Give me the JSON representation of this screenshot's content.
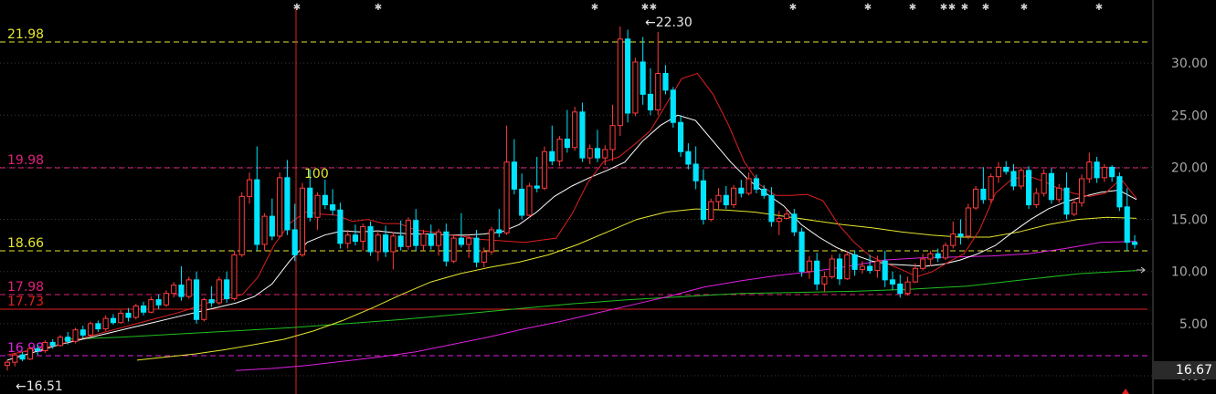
{
  "levels": [
    {
      "label": "21.98",
      "color": "#e6e62e"
    },
    {
      "label": "19.98",
      "color": "#e0207a"
    },
    {
      "label": "18.66",
      "color": "#e6e62e"
    },
    {
      "label": "17.98",
      "color": "#e0207a"
    },
    {
      "label": "17.73",
      "color": "#e02020"
    },
    {
      "label": "16.98",
      "color": "#e020e0"
    }
  ],
  "annotations": {
    "high": "22.30",
    "low": "16.51",
    "marker": "100"
  },
  "current_price": "16.67",
  "chart_data": {
    "type": "candlestick",
    "y_ticks": [
      "30.00",
      "25.00",
      "20.00",
      "15.00",
      "10.00",
      "5.00",
      "0.00"
    ],
    "ylim": [
      0,
      32
    ],
    "ma_colors": {
      "ma_fast": "#e02020",
      "ma_mid": "#ffffff",
      "ma_slow": "#e6e62e",
      "ma_long1": "#e020e0",
      "ma_long2": "#20c020"
    },
    "colors": {
      "up": "#ff3c3c",
      "down": "#00e5ff"
    },
    "candles": [
      [
        1.0,
        1.5,
        0.5,
        1.3
      ],
      [
        1.3,
        2.2,
        0.9,
        2.0
      ],
      [
        2.0,
        2.3,
        1.4,
        1.6
      ],
      [
        1.6,
        2.8,
        1.5,
        2.6
      ],
      [
        2.6,
        3.0,
        2.0,
        2.4
      ],
      [
        2.4,
        3.4,
        2.2,
        3.2
      ],
      [
        3.2,
        3.5,
        2.6,
        2.9
      ],
      [
        2.9,
        3.9,
        2.8,
        3.7
      ],
      [
        3.7,
        4.2,
        3.0,
        3.3
      ],
      [
        3.3,
        4.6,
        3.1,
        4.4
      ],
      [
        4.4,
        4.8,
        3.6,
        3.9
      ],
      [
        3.9,
        5.2,
        3.7,
        5.0
      ],
      [
        5.0,
        5.3,
        4.2,
        4.5
      ],
      [
        4.5,
        5.8,
        4.3,
        5.5
      ],
      [
        5.5,
        5.9,
        4.9,
        5.1
      ],
      [
        5.1,
        6.3,
        5.0,
        6.0
      ],
      [
        6.0,
        6.5,
        5.2,
        5.6
      ],
      [
        5.6,
        6.9,
        5.4,
        6.7
      ],
      [
        6.7,
        7.1,
        5.8,
        6.1
      ],
      [
        6.1,
        7.6,
        6.0,
        7.3
      ],
      [
        7.3,
        7.8,
        6.4,
        6.8
      ],
      [
        6.8,
        8.2,
        6.6,
        7.9
      ],
      [
        7.9,
        9.0,
        7.5,
        8.7
      ],
      [
        8.7,
        10.5,
        7.2,
        7.6
      ],
      [
        7.6,
        9.5,
        7.4,
        9.2
      ],
      [
        9.2,
        10.0,
        5.0,
        5.4
      ],
      [
        5.4,
        7.5,
        5.2,
        7.3
      ],
      [
        7.3,
        8.6,
        6.6,
        7.0
      ],
      [
        7.0,
        9.5,
        6.8,
        9.2
      ],
      [
        9.2,
        10.0,
        7.0,
        7.4
      ],
      [
        7.4,
        12.0,
        7.2,
        11.6
      ],
      [
        11.6,
        17.6,
        11.4,
        17.2
      ],
      [
        17.2,
        19.5,
        16.5,
        18.8
      ],
      [
        18.8,
        22.0,
        12.0,
        12.6
      ],
      [
        12.6,
        15.6,
        12.0,
        15.3
      ],
      [
        15.3,
        17.0,
        13.0,
        13.4
      ],
      [
        13.4,
        19.5,
        13.2,
        19.0
      ],
      [
        19.0,
        20.7,
        13.5,
        14.0
      ],
      [
        14.0,
        16.5,
        11.0,
        11.6
      ],
      [
        11.6,
        18.5,
        11.4,
        18.0
      ],
      [
        18.0,
        19.8,
        14.8,
        15.2
      ],
      [
        15.2,
        17.6,
        14.0,
        17.3
      ],
      [
        17.3,
        18.8,
        16.0,
        16.4
      ],
      [
        16.4,
        17.9,
        15.4,
        15.9
      ],
      [
        15.9,
        16.6,
        12.2,
        12.7
      ],
      [
        12.7,
        14.0,
        12.2,
        13.5
      ],
      [
        13.5,
        14.5,
        12.5,
        12.9
      ],
      [
        12.9,
        14.6,
        12.0,
        14.3
      ],
      [
        14.3,
        14.8,
        11.5,
        11.9
      ],
      [
        11.9,
        13.9,
        11.0,
        13.5
      ],
      [
        13.5,
        14.4,
        11.4,
        11.9
      ],
      [
        11.9,
        13.8,
        10.2,
        13.4
      ],
      [
        13.4,
        14.9,
        12.0,
        12.4
      ],
      [
        12.4,
        15.2,
        12.1,
        14.9
      ],
      [
        14.9,
        16.0,
        12.0,
        12.5
      ],
      [
        12.5,
        14.0,
        12.0,
        13.6
      ],
      [
        13.6,
        14.5,
        12.1,
        12.5
      ],
      [
        12.5,
        14.1,
        11.5,
        13.8
      ],
      [
        13.8,
        14.6,
        10.5,
        11.0
      ],
      [
        11.0,
        13.5,
        10.8,
        13.2
      ],
      [
        13.2,
        15.6,
        12.3,
        12.6
      ],
      [
        12.6,
        13.6,
        11.3,
        13.2
      ],
      [
        13.2,
        14.0,
        10.4,
        10.9
      ],
      [
        10.9,
        12.3,
        10.4,
        11.9
      ],
      [
        11.9,
        14.3,
        11.6,
        14.0
      ],
      [
        14.0,
        16.0,
        13.3,
        13.7
      ],
      [
        13.7,
        24.0,
        13.5,
        20.5
      ],
      [
        20.5,
        22.7,
        17.4,
        17.9
      ],
      [
        17.9,
        19.4,
        15.0,
        15.4
      ],
      [
        15.4,
        18.5,
        15.2,
        18.2
      ],
      [
        18.2,
        21.0,
        17.6,
        18.0
      ],
      [
        18.0,
        22.0,
        17.8,
        21.5
      ],
      [
        21.5,
        24.0,
        20.2,
        20.6
      ],
      [
        20.6,
        23.0,
        20.1,
        22.7
      ],
      [
        22.7,
        25.5,
        21.4,
        21.9
      ],
      [
        21.9,
        25.8,
        21.6,
        25.3
      ],
      [
        25.3,
        26.2,
        20.5,
        20.9
      ],
      [
        20.9,
        22.2,
        20.3,
        21.8
      ],
      [
        21.8,
        23.6,
        20.5,
        20.9
      ],
      [
        20.9,
        22.1,
        20.2,
        21.7
      ],
      [
        21.7,
        26.0,
        20.6,
        24.0
      ],
      [
        24.0,
        33.5,
        23.0,
        32.3
      ],
      [
        32.3,
        33.2,
        24.3,
        25.2
      ],
      [
        25.2,
        30.5,
        24.9,
        30.1
      ],
      [
        30.1,
        32.5,
        26.0,
        27.0
      ],
      [
        27.0,
        29.5,
        25.0,
        25.5
      ],
      [
        25.5,
        33.0,
        25.0,
        29.0
      ],
      [
        29.0,
        29.8,
        27.0,
        27.4
      ],
      [
        27.4,
        27.7,
        23.8,
        24.3
      ],
      [
        24.3,
        25.0,
        21.0,
        21.5
      ],
      [
        21.5,
        22.3,
        19.8,
        20.3
      ],
      [
        20.3,
        22.0,
        17.9,
        18.7
      ],
      [
        18.7,
        19.8,
        14.5,
        15.0
      ],
      [
        15.0,
        17.0,
        14.8,
        16.7
      ],
      [
        16.7,
        18.0,
        16.0,
        17.3
      ],
      [
        17.3,
        18.2,
        16.0,
        16.4
      ],
      [
        16.4,
        18.3,
        16.1,
        18.0
      ],
      [
        18.0,
        18.8,
        17.1,
        17.5
      ],
      [
        17.5,
        19.5,
        17.3,
        18.9
      ],
      [
        18.9,
        19.3,
        17.5,
        17.9
      ],
      [
        17.9,
        18.3,
        17.0,
        17.3
      ],
      [
        17.3,
        18.1,
        14.3,
        14.8
      ],
      [
        14.8,
        15.8,
        13.5,
        15.1
      ],
      [
        15.1,
        16.0,
        15.0,
        15.5
      ],
      [
        15.5,
        16.0,
        13.4,
        13.8
      ],
      [
        13.8,
        14.2,
        9.5,
        10.0
      ],
      [
        10.0,
        11.5,
        9.3,
        11.0
      ],
      [
        11.0,
        11.8,
        8.2,
        8.8
      ],
      [
        8.8,
        10.0,
        8.0,
        9.5
      ],
      [
        9.5,
        11.6,
        9.3,
        11.2
      ],
      [
        11.2,
        11.7,
        8.7,
        9.3
      ],
      [
        9.3,
        12.0,
        9.2,
        11.6
      ],
      [
        11.6,
        12.0,
        9.6,
        10.2
      ],
      [
        10.2,
        11.0,
        9.8,
        10.5
      ],
      [
        10.5,
        11.6,
        9.8,
        10.1
      ],
      [
        10.1,
        11.5,
        9.4,
        11.0
      ],
      [
        11.0,
        12.0,
        8.5,
        9.2
      ],
      [
        9.2,
        10.0,
        8.2,
        8.8
      ],
      [
        8.8,
        9.7,
        7.5,
        7.9
      ],
      [
        7.9,
        9.5,
        7.7,
        9.0
      ],
      [
        9.0,
        10.8,
        8.9,
        10.3
      ],
      [
        10.3,
        11.7,
        10.1,
        11.2
      ],
      [
        11.2,
        12.0,
        10.5,
        11.7
      ],
      [
        11.7,
        12.2,
        10.9,
        11.3
      ],
      [
        11.3,
        12.8,
        11.1,
        12.5
      ],
      [
        12.5,
        14.8,
        12.2,
        13.6
      ],
      [
        13.6,
        15.0,
        12.6,
        13.4
      ],
      [
        13.4,
        16.5,
        13.1,
        16.1
      ],
      [
        16.1,
        18.2,
        15.9,
        17.9
      ],
      [
        17.9,
        20.0,
        16.5,
        16.9
      ],
      [
        16.9,
        19.4,
        16.6,
        19.1
      ],
      [
        19.1,
        20.5,
        18.5,
        20.0
      ],
      [
        20.0,
        20.6,
        19.3,
        19.6
      ],
      [
        19.6,
        20.3,
        17.8,
        18.2
      ],
      [
        18.2,
        20.0,
        17.9,
        19.7
      ],
      [
        19.7,
        20.1,
        16.0,
        16.4
      ],
      [
        16.4,
        18.0,
        16.1,
        17.5
      ],
      [
        17.5,
        19.8,
        17.2,
        19.4
      ],
      [
        19.4,
        19.9,
        16.5,
        16.9
      ],
      [
        16.9,
        18.4,
        16.6,
        18.0
      ],
      [
        18.0,
        19.5,
        15.0,
        15.5
      ],
      [
        15.5,
        17.0,
        15.3,
        16.6
      ],
      [
        16.6,
        19.3,
        16.2,
        18.9
      ],
      [
        18.9,
        21.4,
        18.5,
        20.5
      ],
      [
        20.5,
        21.0,
        18.5,
        19.0
      ],
      [
        19.0,
        20.3,
        18.6,
        20.0
      ],
      [
        20.0,
        20.2,
        18.6,
        19.1
      ],
      [
        19.1,
        19.5,
        15.8,
        16.2
      ],
      [
        16.2,
        18.0,
        12.0,
        12.8
      ],
      [
        12.8,
        13.5,
        12.2,
        12.6
      ]
    ],
    "ma_fast": [
      2,
      2.3,
      2.6,
      2.9,
      3.3,
      3.7,
      4.1,
      4.5,
      4.9,
      5.3,
      5.7,
      6.1,
      6.6,
      7.1,
      7.4,
      7.8,
      9.5,
      12.5,
      14.6,
      15.7,
      15.5,
      15.4,
      14.8,
      15.0,
      14.6,
      14.6,
      14.0,
      13.8,
      13.5,
      13.4,
      13.1,
      13.0,
      12.9,
      12.8,
      13.0,
      13.2,
      15.5,
      18.5,
      20.5,
      21.0,
      22.2,
      23.5,
      26.0,
      28.5,
      29.0,
      27.0,
      24.0,
      20.5,
      18.3,
      17.3,
      17.3,
      17.4,
      16.8,
      14.5,
      12.8,
      11.5,
      10.8,
      10.2,
      9.5,
      10.0,
      10.9,
      11.7,
      14.0,
      17.5,
      18.8,
      19.2,
      18.7,
      18.0,
      17.5,
      17.2,
      17.5,
      18.9,
      17.0
    ],
    "ma_mid": [
      1.5,
      2.0,
      2.5,
      3.0,
      3.4,
      3.8,
      4.2,
      4.6,
      5.0,
      5.4,
      5.8,
      6.2,
      6.6,
      7.0,
      7.6,
      8.8,
      11.0,
      12.8,
      13.5,
      13.9,
      13.8,
      13.9,
      13.7,
      13.6,
      13.6,
      13.5,
      13.5,
      13.6,
      13.8,
      14.5,
      15.7,
      17.2,
      18.2,
      19.0,
      19.7,
      20.5,
      22.5,
      24.0,
      25.0,
      24.5,
      22.5,
      20.5,
      18.8,
      17.5,
      16.3,
      14.5,
      13.3,
      12.3,
      11.6,
      11.0,
      10.7,
      10.6,
      10.5,
      10.7,
      11.1,
      11.7,
      12.5,
      13.8,
      15.0,
      16.0,
      16.7,
      17.2,
      17.6,
      17.8,
      16.9
    ],
    "ma_slow": [
      1.5,
      1.8,
      2.1,
      2.5,
      3.0,
      3.5,
      4.3,
      5.3,
      6.5,
      7.8,
      9.0,
      9.8,
      10.4,
      10.9,
      11.6,
      12.6,
      13.8,
      15.0,
      15.7,
      16.0,
      15.9,
      15.7,
      15.3,
      14.9,
      14.5,
      14.2,
      13.8,
      13.5,
      13.3,
      13.3,
      13.8,
      14.5,
      15.0,
      15.2,
      15.1
    ],
    "ma_long1": [
      0.5,
      0.7,
      1.0,
      1.4,
      1.8,
      2.3,
      3.0,
      3.7,
      4.5,
      5.2,
      6.0,
      6.8,
      7.6,
      8.5,
      9.1,
      9.6,
      10.0,
      10.5,
      11.1,
      11.3,
      11.4,
      11.5,
      11.7,
      12.2,
      12.8,
      12.9
    ],
    "ma_long2": [
      3.5,
      3.7,
      4.0,
      4.3,
      4.6,
      5.0,
      5.4,
      5.9,
      6.4,
      6.9,
      7.3,
      7.6,
      7.9,
      8.0,
      8.1,
      8.3,
      8.6,
      9.2,
      9.8,
      10.1
    ]
  }
}
